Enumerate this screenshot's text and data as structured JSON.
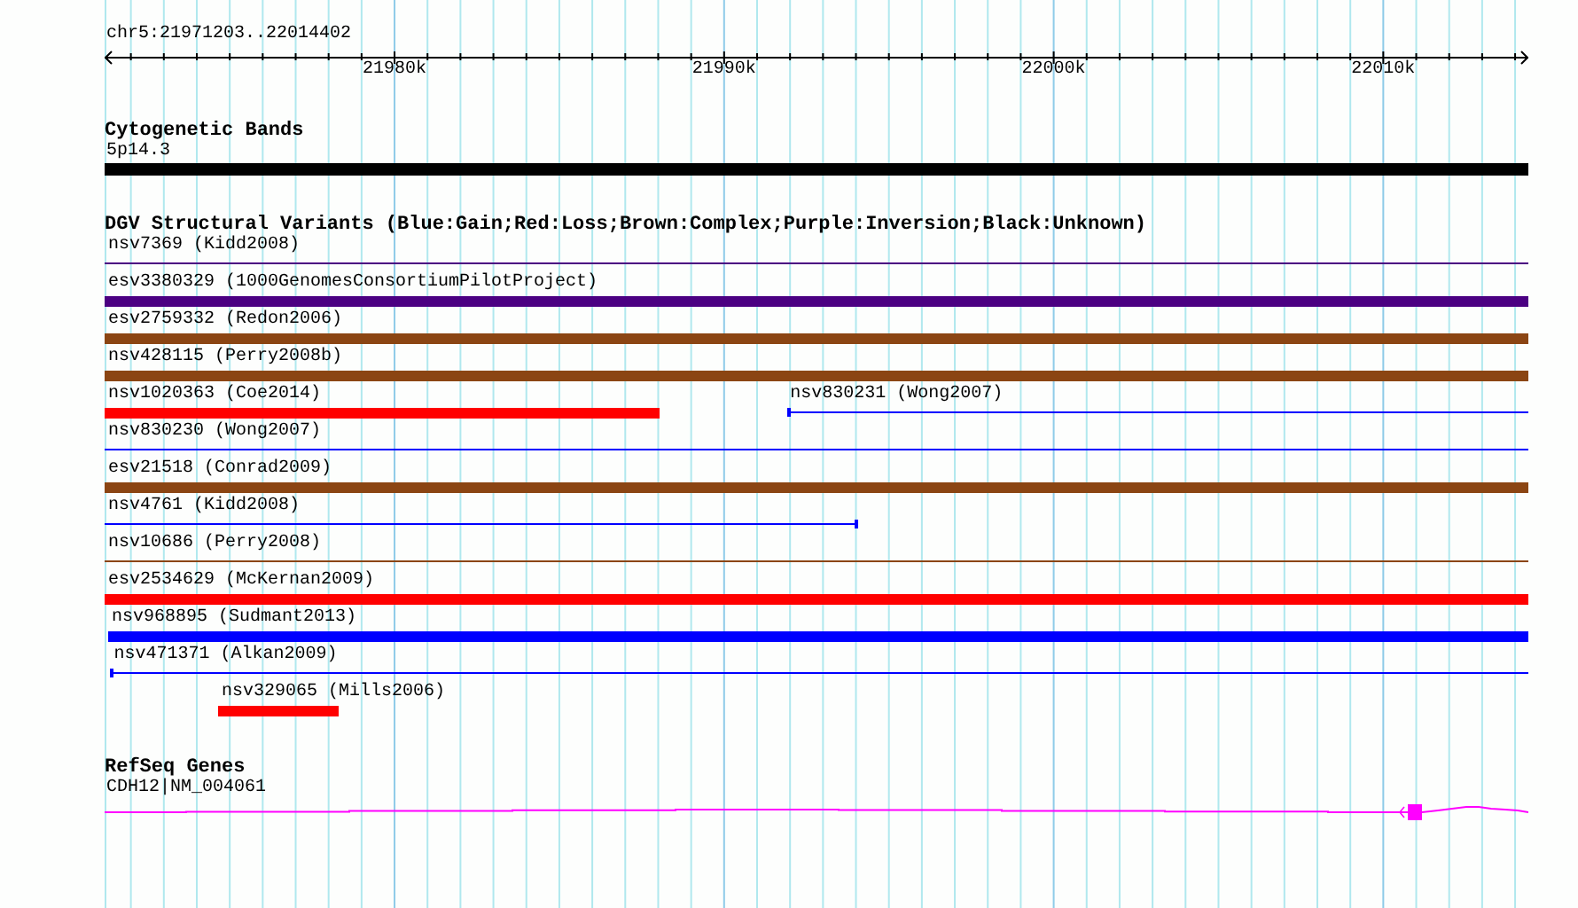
{
  "ruler": {
    "position": "chr5:21971203..22014402",
    "tick_labels": [
      "21980k",
      "21990k",
      "22000k",
      "22010k"
    ]
  },
  "cytogenetic_bands": {
    "title": "Cytogenetic Bands",
    "band": {
      "label": "5p14.3"
    }
  },
  "dgv": {
    "title": "DGV Structural Variants (Blue:Gain;Red:Loss;Brown:Complex;Purple:Inversion;Black:Unknown)",
    "rows": [
      {
        "features": [
          {
            "label": "nsv7369 (Kidd2008)",
            "kind": "line",
            "color": "#4b0082"
          }
        ]
      },
      {
        "features": [
          {
            "label": "esv3380329 (1000GenomesConsortiumPilotProject)",
            "kind": "bar",
            "color": "#4b0082"
          }
        ]
      },
      {
        "features": [
          {
            "label": "esv2759332 (Redon2006)",
            "kind": "bar",
            "color": "#8b4513"
          }
        ]
      },
      {
        "features": [
          {
            "label": "nsv428115 (Perry2008b)",
            "kind": "bar",
            "color": "#8b4513"
          }
        ]
      },
      {
        "features": [
          {
            "label": "nsv1020363 (Coe2014)",
            "kind": "bar",
            "color": "#ff0000"
          },
          {
            "label": "nsv830231 (Wong2007)",
            "kind": "line",
            "color": "#0000ff"
          }
        ]
      },
      {
        "features": [
          {
            "label": "nsv830230 (Wong2007)",
            "kind": "line",
            "color": "#0000ff"
          }
        ]
      },
      {
        "features": [
          {
            "label": "esv21518 (Conrad2009)",
            "kind": "bar",
            "color": "#8b4513"
          }
        ]
      },
      {
        "features": [
          {
            "label": "nsv4761 (Kidd2008)",
            "kind": "line",
            "color": "#0000ff"
          }
        ]
      },
      {
        "features": [
          {
            "label": "nsv10686 (Perry2008)",
            "kind": "line",
            "color": "#8b4513"
          }
        ]
      },
      {
        "features": [
          {
            "label": "esv2534629 (McKernan2009)",
            "kind": "bar",
            "color": "#ff0000"
          }
        ]
      },
      {
        "features": [
          {
            "label": "nsv968895 (Sudmant2013)",
            "kind": "bar",
            "color": "#0000ff"
          }
        ]
      },
      {
        "features": [
          {
            "label": "nsv471371 (Alkan2009)",
            "kind": "line",
            "color": "#0000ff"
          }
        ]
      },
      {
        "features": [
          {
            "label": "nsv329065 (Mills2006)",
            "kind": "bar",
            "color": "#ff0000"
          }
        ]
      }
    ]
  },
  "refseq_genes": {
    "title": "RefSeq Genes",
    "gene": {
      "label": "CDH12|NM_004061"
    }
  }
}
